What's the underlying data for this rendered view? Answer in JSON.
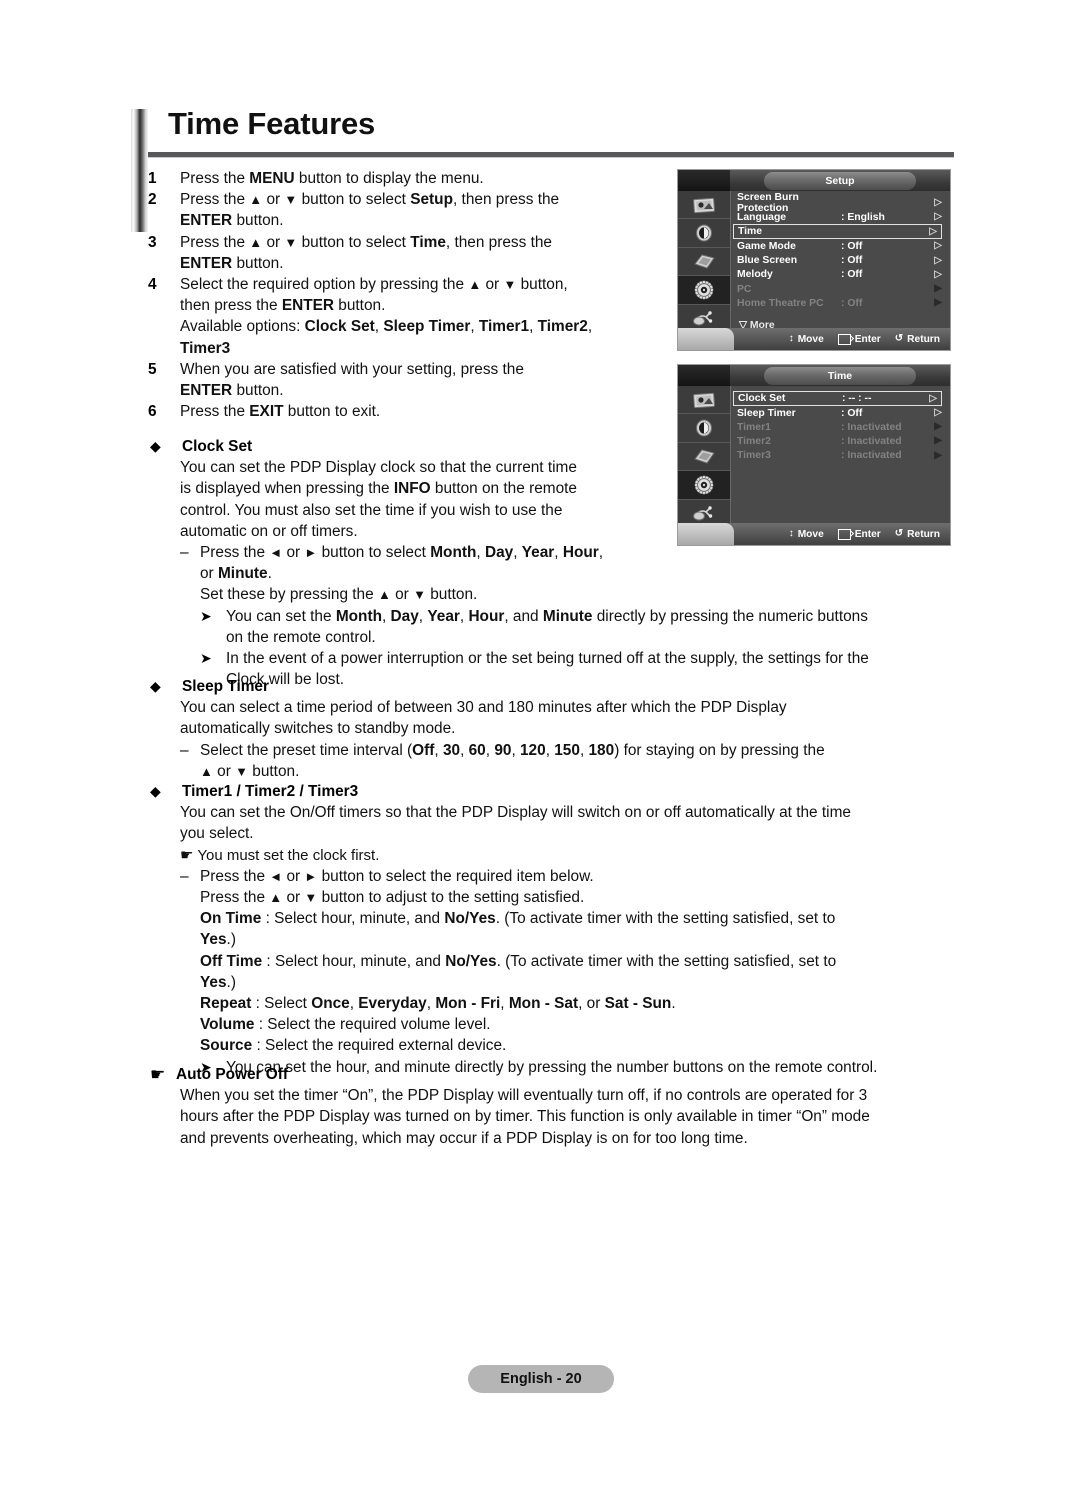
{
  "page": {
    "title": "Time Features",
    "footer_badge": "English - 20"
  },
  "steps": [
    {
      "num": "1",
      "lines": [
        [
          {
            "t": "Press the "
          },
          {
            "t": "MENU",
            "b": true
          },
          {
            "t": " button to display the menu."
          }
        ]
      ]
    },
    {
      "num": "2",
      "lines": [
        [
          {
            "t": "Press the "
          },
          {
            "t": "▲",
            "arrow": true
          },
          {
            "t": " or "
          },
          {
            "t": "▼",
            "arrow": true
          },
          {
            "t": " button to select "
          },
          {
            "t": "Setup",
            "b": true
          },
          {
            "t": ", then press the"
          }
        ],
        [
          {
            "t": "ENTER",
            "b": true
          },
          {
            "t": " button."
          }
        ]
      ]
    },
    {
      "num": "3",
      "lines": [
        [
          {
            "t": "Press the "
          },
          {
            "t": "▲",
            "arrow": true
          },
          {
            "t": " or "
          },
          {
            "t": "▼",
            "arrow": true
          },
          {
            "t": " button to select "
          },
          {
            "t": "Time",
            "b": true
          },
          {
            "t": ", then press the"
          }
        ],
        [
          {
            "t": "ENTER",
            "b": true
          },
          {
            "t": " button."
          }
        ]
      ]
    },
    {
      "num": "4",
      "lines": [
        [
          {
            "t": "Select the required option by pressing the "
          },
          {
            "t": "▲",
            "arrow": true
          },
          {
            "t": " or "
          },
          {
            "t": "▼",
            "arrow": true
          },
          {
            "t": " button,"
          }
        ],
        [
          {
            "t": "then press the "
          },
          {
            "t": "ENTER",
            "b": true
          },
          {
            "t": " button."
          }
        ],
        [
          {
            "t": "Available options: "
          },
          {
            "t": "Clock Set",
            "b": true
          },
          {
            "t": ", "
          },
          {
            "t": "Sleep Timer",
            "b": true
          },
          {
            "t": ", "
          },
          {
            "t": "Timer1",
            "b": true
          },
          {
            "t": ", "
          },
          {
            "t": "Timer2",
            "b": true
          },
          {
            "t": ","
          }
        ],
        [
          {
            "t": "Timer3",
            "b": true
          }
        ]
      ]
    },
    {
      "num": "5",
      "lines": [
        [
          {
            "t": "When you are satisfied with your setting, press the"
          }
        ],
        [
          {
            "t": "ENTER",
            "b": true
          },
          {
            "t": " button."
          }
        ]
      ]
    },
    {
      "num": "6",
      "lines": [
        [
          {
            "t": "Press the "
          },
          {
            "t": "EXIT",
            "b": true
          },
          {
            "t": " button to exit."
          }
        ]
      ]
    }
  ],
  "sections": {
    "clock_set": {
      "bullet": "◆",
      "heading": "Clock Set",
      "body": [
        [
          {
            "t": "You can set the PDP Display clock so that the current time"
          }
        ],
        [
          {
            "t": "is displayed when pressing the "
          },
          {
            "t": "INFO",
            "b": true
          },
          {
            "t": " button on the remote"
          }
        ],
        [
          {
            "t": "control. You must also set the time if you wish to use the"
          }
        ],
        [
          {
            "t": "automatic on or off timers."
          }
        ]
      ],
      "dash1": [
        [
          {
            "t": "Press the "
          },
          {
            "t": "◄",
            "arrow": true
          },
          {
            "t": " or "
          },
          {
            "t": "►",
            "arrow": true
          },
          {
            "t": " button to select "
          },
          {
            "t": "Month",
            "b": true
          },
          {
            "t": ", "
          },
          {
            "t": "Day",
            "b": true
          },
          {
            "t": ", "
          },
          {
            "t": "Year",
            "b": true
          },
          {
            "t": ", "
          },
          {
            "t": "Hour",
            "b": true
          },
          {
            "t": ","
          }
        ],
        [
          {
            "t": "or "
          },
          {
            "t": "Minute",
            "b": true
          },
          {
            "t": "."
          }
        ],
        [
          {
            "t": "Set these by pressing the "
          },
          {
            "t": "▲",
            "arrow": true
          },
          {
            "t": " or "
          },
          {
            "t": "▼",
            "arrow": true
          },
          {
            "t": " button."
          }
        ]
      ],
      "notes": [
        [
          [
            {
              "t": "You can set the "
            },
            {
              "t": "Month",
              "b": true
            },
            {
              "t": ", "
            },
            {
              "t": "Day",
              "b": true
            },
            {
              "t": ", "
            },
            {
              "t": "Year",
              "b": true
            },
            {
              "t": ", "
            },
            {
              "t": "Hour",
              "b": true
            },
            {
              "t": ", and "
            },
            {
              "t": "Minute",
              "b": true
            },
            {
              "t": " directly by pressing the numeric buttons"
            }
          ],
          [
            {
              "t": "on the remote control."
            }
          ]
        ],
        [
          [
            {
              "t": "In the event of a power interruption or the set being turned off at the supply, the settings for the"
            }
          ],
          [
            {
              "t": "Clock will be lost."
            }
          ]
        ]
      ]
    },
    "sleep_timer": {
      "bullet": "◆",
      "heading": "Sleep Timer",
      "body": [
        [
          {
            "t": "You can select a time period of between 30 and 180 minutes after which the PDP Display"
          }
        ],
        [
          {
            "t": "automatically switches to standby mode."
          }
        ]
      ],
      "dash1": [
        [
          {
            "t": "Select the preset time interval ("
          },
          {
            "t": "Off",
            "b": true
          },
          {
            "t": ", "
          },
          {
            "t": "30",
            "b": true
          },
          {
            "t": ", "
          },
          {
            "t": "60",
            "b": true
          },
          {
            "t": ", "
          },
          {
            "t": "90",
            "b": true
          },
          {
            "t": ", "
          },
          {
            "t": "120",
            "b": true
          },
          {
            "t": ", "
          },
          {
            "t": "150",
            "b": true
          },
          {
            "t": ", "
          },
          {
            "t": "180",
            "b": true
          },
          {
            "t": ") for staying on by pressing the"
          }
        ],
        [
          {
            "t": "▲",
            "arrow": true
          },
          {
            "t": " or "
          },
          {
            "t": "▼",
            "arrow": true
          },
          {
            "t": " button."
          }
        ]
      ]
    },
    "timers": {
      "bullet": "◆",
      "heading": "Timer1 / Timer2 / Timer3",
      "body": [
        [
          {
            "t": "You can set the On/Off timers so that the PDP Display will switch on or off automatically at the time"
          }
        ],
        [
          {
            "t": "you select."
          }
        ]
      ],
      "hand_note": "You must set the clock first.",
      "dash1": [
        [
          {
            "t": "Press the "
          },
          {
            "t": "◄",
            "arrow": true
          },
          {
            "t": " or "
          },
          {
            "t": "►",
            "arrow": true
          },
          {
            "t": " button to select the required item below."
          }
        ],
        [
          {
            "t": "Press the "
          },
          {
            "t": "▲",
            "arrow": true
          },
          {
            "t": " or "
          },
          {
            "t": "▼",
            "arrow": true
          },
          {
            "t": " button to adjust to the setting satisfied."
          }
        ],
        [
          {
            "t": "On Time",
            "b": true
          },
          {
            "t": " : Select hour, minute, and "
          },
          {
            "t": "No/Yes",
            "b": true
          },
          {
            "t": ". (To activate timer with the setting satisfied, set to"
          }
        ],
        [
          {
            "t": "Yes",
            "b": true
          },
          {
            "t": ".)"
          }
        ],
        [
          {
            "t": "Off Time",
            "b": true
          },
          {
            "t": " : Select hour, minute, and "
          },
          {
            "t": "No/Yes",
            "b": true
          },
          {
            "t": ". (To activate timer with the setting satisfied, set to"
          }
        ],
        [
          {
            "t": "Yes",
            "b": true
          },
          {
            "t": ".)"
          }
        ],
        [
          {
            "t": "Repeat",
            "b": true
          },
          {
            "t": " : Select "
          },
          {
            "t": "Once",
            "b": true
          },
          {
            "t": ", "
          },
          {
            "t": "Everyday",
            "b": true
          },
          {
            "t": ", "
          },
          {
            "t": "Mon - Fri",
            "b": true
          },
          {
            "t": ", "
          },
          {
            "t": "Mon - Sat",
            "b": true
          },
          {
            "t": ", or "
          },
          {
            "t": "Sat - Sun",
            "b": true
          },
          {
            "t": "."
          }
        ],
        [
          {
            "t": "Volume",
            "b": true
          },
          {
            "t": " : Select the required volume level."
          }
        ],
        [
          {
            "t": "Source",
            "b": true
          },
          {
            "t": " : Select the required external device."
          }
        ]
      ],
      "notes": [
        [
          [
            {
              "t": "You can set the hour, and minute directly by pressing the number buttons on the remote control."
            }
          ]
        ]
      ]
    },
    "auto_power_off": {
      "bullet": "☛",
      "heading": "Auto Power Off",
      "body": [
        [
          {
            "t": "When you set the timer “On”, the PDP Display will eventually turn off, if no controls are operated for 3"
          }
        ],
        [
          {
            "t": "hours after the PDP Display was turned on by timer. This function is only available in timer “On” mode"
          }
        ],
        [
          {
            "t": "and prevents overheating, which may occur if a PDP Display is on for too long time."
          }
        ]
      ]
    }
  },
  "osd_setup": {
    "title": "Setup",
    "icons": [
      "picture-icon",
      "sound-icon",
      "channel-icon",
      "setup-icon",
      "input-icon"
    ],
    "active_icon_index": 3,
    "rows": [
      {
        "name": "Screen Burn Protection",
        "value": "",
        "arrow": "hollow",
        "selected": false,
        "dim": false
      },
      {
        "name": "Language",
        "value": ": English",
        "arrow": "hollow",
        "selected": false,
        "dim": false
      },
      {
        "name": "Time",
        "value": "",
        "arrow": "hollow",
        "selected": true,
        "dim": false
      },
      {
        "name": "Game Mode",
        "value": ": Off",
        "arrow": "hollow",
        "selected": false,
        "dim": false
      },
      {
        "name": "Blue Screen",
        "value": ": Off",
        "arrow": "hollow",
        "selected": false,
        "dim": false
      },
      {
        "name": "Melody",
        "value": ": Off",
        "arrow": "hollow",
        "selected": false,
        "dim": false
      },
      {
        "name": "PC",
        "value": "",
        "arrow": "filled",
        "selected": false,
        "dim": true
      },
      {
        "name": "Home Theatre PC",
        "value": ": Off",
        "arrow": "filled",
        "selected": false,
        "dim": true
      }
    ],
    "more_label": "More",
    "more_glyph": "▽",
    "footer": {
      "move": "Move",
      "enter": "Enter",
      "return": "Return",
      "move_glyph": "↕",
      "return_glyph": "↺"
    }
  },
  "osd_time": {
    "title": "Time",
    "icons": [
      "picture-icon",
      "sound-icon",
      "channel-icon",
      "setup-icon",
      "input-icon"
    ],
    "active_icon_index": 3,
    "rows": [
      {
        "name": "Clock Set",
        "value": ": -- : --",
        "arrow": "hollow",
        "selected": true,
        "dim": false
      },
      {
        "name": "Sleep Timer",
        "value": ": Off",
        "arrow": "hollow",
        "selected": false,
        "dim": false
      },
      {
        "name": "Timer1",
        "value": ": Inactivated",
        "arrow": "filled",
        "selected": false,
        "dim": true
      },
      {
        "name": "Timer2",
        "value": ": Inactivated",
        "arrow": "filled",
        "selected": false,
        "dim": true
      },
      {
        "name": "Timer3",
        "value": ": Inactivated",
        "arrow": "filled",
        "selected": false,
        "dim": true
      }
    ],
    "footer": {
      "move": "Move",
      "enter": "Enter",
      "return": "Return",
      "move_glyph": "↕",
      "return_glyph": "↺"
    }
  }
}
